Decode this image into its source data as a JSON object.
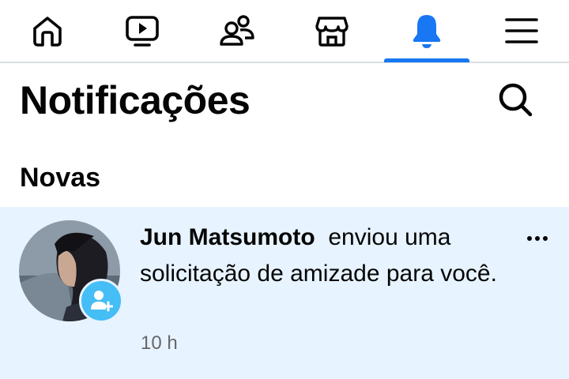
{
  "nav": {
    "items": [
      {
        "icon": "home-icon"
      },
      {
        "icon": "video-icon"
      },
      {
        "icon": "friends-icon"
      },
      {
        "icon": "marketplace-icon"
      },
      {
        "icon": "notifications-bell-icon",
        "active": true
      },
      {
        "icon": "menu-icon"
      }
    ],
    "accent_color": "#1877f2"
  },
  "header": {
    "title": "Notificações",
    "search_icon": "search-icon"
  },
  "sections": [
    {
      "title": "Novas",
      "notifications": [
        {
          "actor": "Jun Matsumoto",
          "message": "enviou uma solicitação de amizade para você.",
          "time": "10 h",
          "badge_icon": "friend-request-icon",
          "badge_color": "#45bdf5",
          "unread_background": "#e7f3ff"
        }
      ]
    }
  ]
}
